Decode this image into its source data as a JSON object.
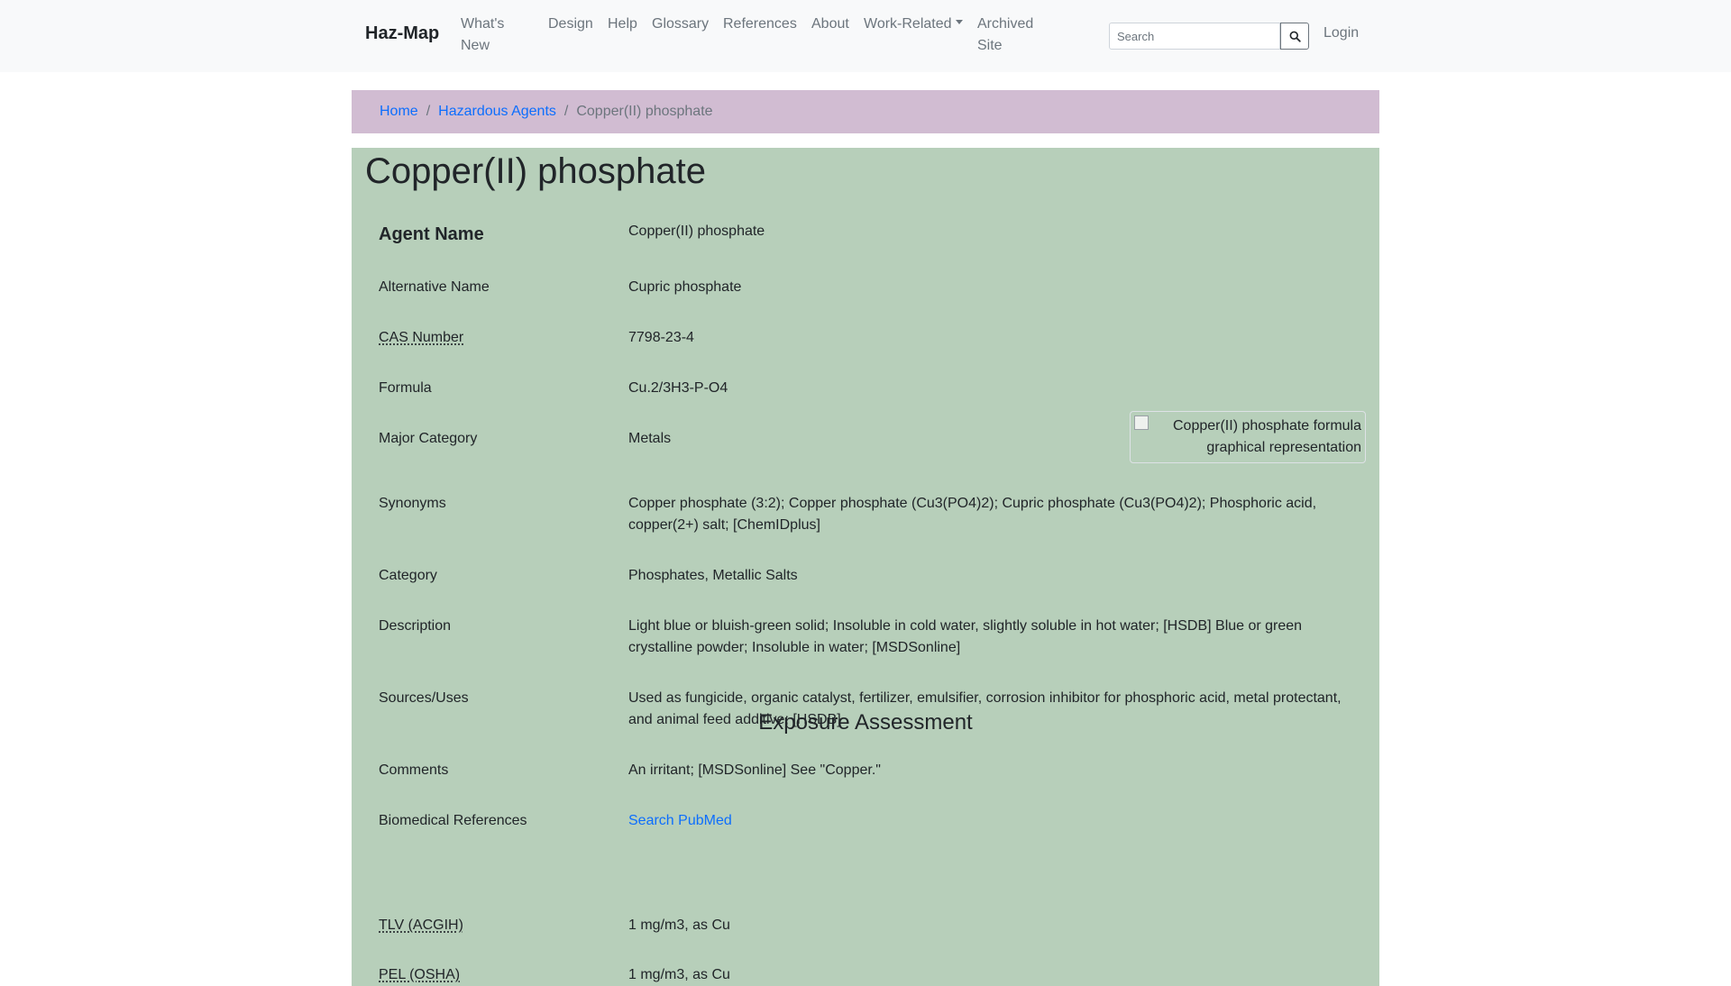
{
  "nav": {
    "brand": "Haz-Map",
    "items": [
      "What's",
      "New",
      "Design",
      "Help",
      "Glossary",
      "References",
      "About",
      "Work-Related",
      "Archived",
      "Site"
    ],
    "whats_new_1": "What's",
    "whats_new_2": "New",
    "design": "Design",
    "help": "Help",
    "glossary": "Glossary",
    "references": "References",
    "about": "About",
    "work_related": "Work-Related",
    "archived_1": "Archived",
    "archived_2": "Site",
    "search_placeholder": "Search",
    "login": "Login"
  },
  "breadcrumb": {
    "home": "Home",
    "agents": "Hazardous Agents",
    "current": "Copper(II) phosphate"
  },
  "title": "Copper(II) phosphate",
  "rows": {
    "agent_name": {
      "label": "Agent Name",
      "value": "Copper(II) phosphate"
    },
    "alt_name": {
      "label": "Alternative Name",
      "value": "Cupric phosphate"
    },
    "cas": {
      "label": "CAS Number",
      "value": "7798-23-4"
    },
    "formula": {
      "label": "Formula",
      "value": "Cu.2/3H3-P-O4"
    },
    "major_category": {
      "label": "Major Category",
      "value": "Metals"
    },
    "synonyms": {
      "label": "Synonyms",
      "value_1": "Copper phosphate (3:2); Copper phosphate (Cu3(PO4)2); Cupric phosphate (Cu3(PO4)2); Phosphoric acid,",
      "value_2": "copper(2+) salt; [ChemIDplus]"
    },
    "category": {
      "label": "Category",
      "value": "Phosphates, Metallic Salts"
    },
    "description": {
      "label": "Description",
      "value_1": "Light blue or bluish-green solid; Insoluble in cold water, slightly soluble in hot water; [HSDB] Blue or green",
      "value_2": "crystalline powder; Insoluble in water; [MSDSonline]"
    },
    "sources": {
      "label": "Sources/Uses",
      "value_1": "Used as fungicide, organic catalyst, fertilizer, emulsifier, corrosion inhibitor for phosphoric acid, metal protectant,",
      "value_2": "and animal feed additive; [HSDB]"
    },
    "comments": {
      "label": "Comments",
      "value": "An irritant; [MSDSonline] See \"Copper.\""
    },
    "biomed": {
      "label": "Biomedical References",
      "value": "Search PubMed"
    }
  },
  "formula_image_alt_1": "Copper(II) phosphate formula",
  "formula_image_alt_2": "graphical representation",
  "exposure": {
    "title": "Exposure Assessment",
    "tlv": {
      "label": "TLV (ACGIH)",
      "value": "1 mg/m3, as Cu"
    },
    "pel": {
      "label": "PEL (OSHA)",
      "value": "1 mg/m3, as Cu"
    }
  },
  "colors": {
    "breadcrumb_bg": "#d1bcd2",
    "card_bg": "#b7cfba",
    "link": "#0d6efd"
  }
}
